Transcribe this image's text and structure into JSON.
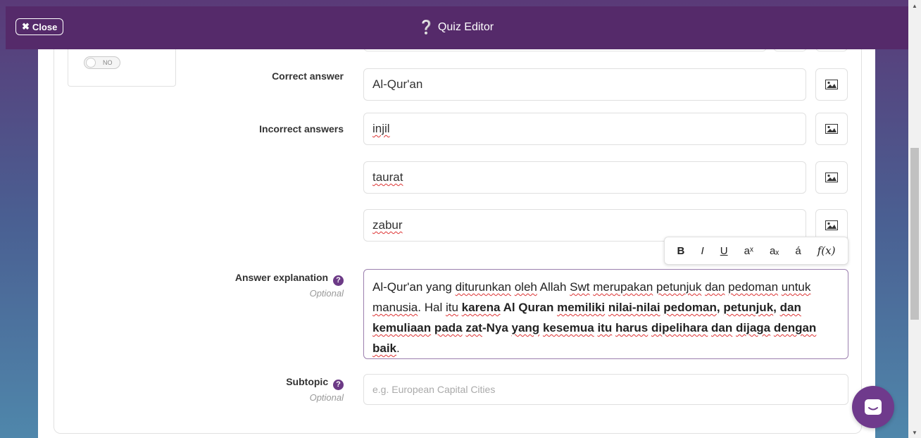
{
  "header": {
    "close_label": "Close",
    "title": "Quiz Editor"
  },
  "side_card": {
    "toggle_value": "NO"
  },
  "form": {
    "correct_label": "Correct answer",
    "correct_value": "Al-Qur'an",
    "incorrect_label": "Incorrect answers",
    "incorrect_values": [
      "injil",
      "taurat",
      "zabur"
    ],
    "explanation_label": "Answer explanation",
    "explanation_sub": "Optional",
    "subtopic_label": "Subtopic",
    "subtopic_sub": "Optional",
    "subtopic_placeholder": "e.g. European Capital Cities"
  },
  "format_toolbar": {
    "bold": "B",
    "italic": "I",
    "underline": "U",
    "superscript": "aˣ",
    "subscript": "aₓ",
    "accent": "á",
    "formula": "f(x)"
  },
  "colors": {
    "accent": "#552a6a",
    "help": "#6c3a86"
  },
  "icons": [
    "close-icon",
    "question-mark-icon",
    "image-icon",
    "help-icon",
    "chat-icon"
  ]
}
